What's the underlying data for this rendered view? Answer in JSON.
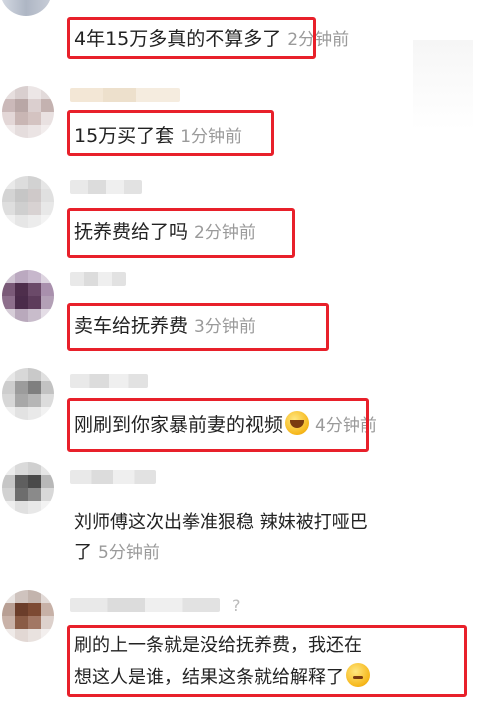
{
  "comments": [
    {
      "text": "4年15万多真的不算多了",
      "time": "2分钟前"
    },
    {
      "text": "15万买了套",
      "time": "1分钟前"
    },
    {
      "text": "抚养费给了吗",
      "time": "2分钟前"
    },
    {
      "text": "卖车给抚养费",
      "time": "3分钟前"
    },
    {
      "text": "刚刷到你家暴前妻的视频",
      "time": "4分钟前",
      "emoji": "rofl-emoji"
    },
    {
      "line1": "刘师傅这次出拳准狠稳 辣妹被打哑巴",
      "line2": "了",
      "time": "5分钟前"
    },
    {
      "line1": "刷的上一条就是没给抚养费，我还在",
      "line2": "想这人是谁，结果这条就给解释了",
      "emoji": "sweat-smile-emoji"
    }
  ],
  "colors": {
    "highlight": "#e8202a",
    "time": "#9a9a9a",
    "text": "#222222"
  }
}
